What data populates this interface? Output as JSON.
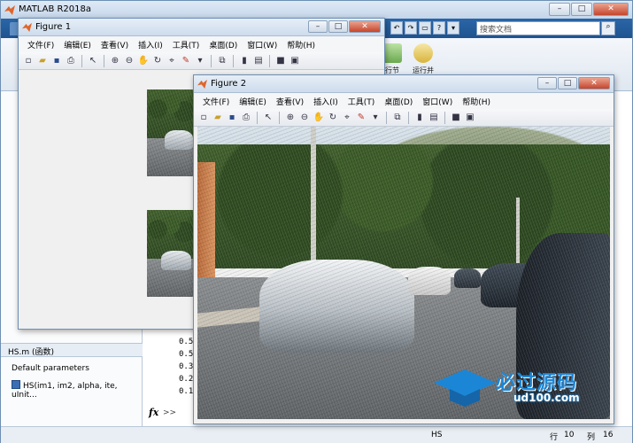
{
  "app": {
    "title": "MATLAB R2018a",
    "search_placeholder": "搜索文档"
  },
  "ribbon": {
    "buttons": [
      {
        "label": "行节"
      },
      {
        "label": "运行并"
      }
    ],
    "tab_colors": [
      "#ffffff",
      "#5f8fc4",
      "#5f8fc4",
      "#5f8fc4"
    ]
  },
  "left_panel": {
    "detail_title": "HS.m  (函数)",
    "detail_lines": [
      "Default parameters",
      "HS(im1, im2, alpha, ite, uInit..."
    ]
  },
  "command_window": {
    "values": [
      "0.5",
      "0.5",
      "0.3",
      "0.2",
      "0.1"
    ],
    "prompt": "fx",
    "prompt_arrow": ">>"
  },
  "status_bar": {
    "file": "HS",
    "row_label": "行",
    "row_value": "10",
    "col_label": "列",
    "col_value": "16"
  },
  "figure1": {
    "title": "Figure 1",
    "menu": [
      "文件(F)",
      "编辑(E)",
      "查看(V)",
      "插入(I)",
      "工具(T)",
      "桌面(D)",
      "窗口(W)",
      "帮助(H)"
    ]
  },
  "figure2": {
    "title": "Figure 2",
    "menu": [
      "文件(F)",
      "编辑(E)",
      "查看(V)",
      "插入(I)",
      "工具(T)",
      "桌面(D)",
      "窗口(W)",
      "帮助(H)"
    ]
  },
  "toolbar_icons": [
    "new-icon",
    "open-icon",
    "save-icon",
    "print-icon",
    "pointer-icon",
    "zoom-in-icon",
    "zoom-out-icon",
    "pan-icon",
    "rotate-icon",
    "data-cursor-icon",
    "brush-icon",
    "link-icon",
    "colorbar-icon",
    "legend-icon",
    "hide-plot-tools-icon",
    "show-plot-tools-icon"
  ],
  "watermark": {
    "text": "必过源码",
    "sub": "ud100.com"
  }
}
